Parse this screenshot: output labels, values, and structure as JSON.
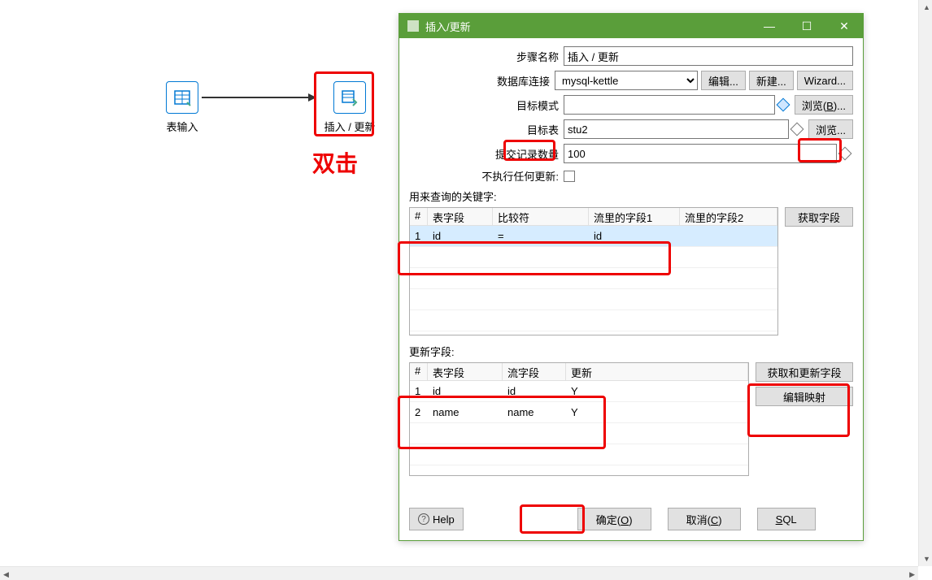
{
  "canvas": {
    "node1_label": "表输入",
    "node2_label": "插入 / 更新",
    "double_click_text": "双击"
  },
  "dialog": {
    "title": "插入/更新",
    "form": {
      "step_name_label": "步骤名称",
      "step_name_value": "插入 / 更新",
      "db_conn_label": "数据库连接",
      "db_conn_value": "mysql-kettle",
      "edit_btn": "编辑...",
      "new_btn": "新建...",
      "wizard_btn": "Wizard...",
      "target_schema_label": "目标模式",
      "target_schema_value": "",
      "browse_b_btn": "浏览(B)...",
      "target_table_label": "目标表",
      "target_table_value": "stu2",
      "browse_btn": "浏览...",
      "commit_size_label": "提交记录数量",
      "commit_size_value": "100",
      "no_update_label": "不执行任何更新:"
    },
    "lookup": {
      "section_label": "用来查询的关键字:",
      "get_fields_btn": "获取字段",
      "headers": {
        "num": "#",
        "table_field": "表字段",
        "comparator": "比较符",
        "stream_field1": "流里的字段1",
        "stream_field2": "流里的字段2"
      },
      "rows": [
        {
          "num": "1",
          "table_field": "id",
          "comparator": "=",
          "stream_field1": "id",
          "stream_field2": ""
        }
      ]
    },
    "update": {
      "section_label": "更新字段:",
      "get_update_btn": "获取和更新字段",
      "edit_mapping_btn": "编辑映射",
      "headers": {
        "num": "#",
        "table_field": "表字段",
        "stream_field": "流字段",
        "update": "更新"
      },
      "rows": [
        {
          "num": "1",
          "table_field": "id",
          "stream_field": "id",
          "update": "Y"
        },
        {
          "num": "2",
          "table_field": "name",
          "stream_field": "name",
          "update": "Y"
        }
      ]
    },
    "footer": {
      "help": "Help",
      "ok": "确定(O)",
      "cancel": "取消(C)",
      "sql": "SQL"
    }
  }
}
